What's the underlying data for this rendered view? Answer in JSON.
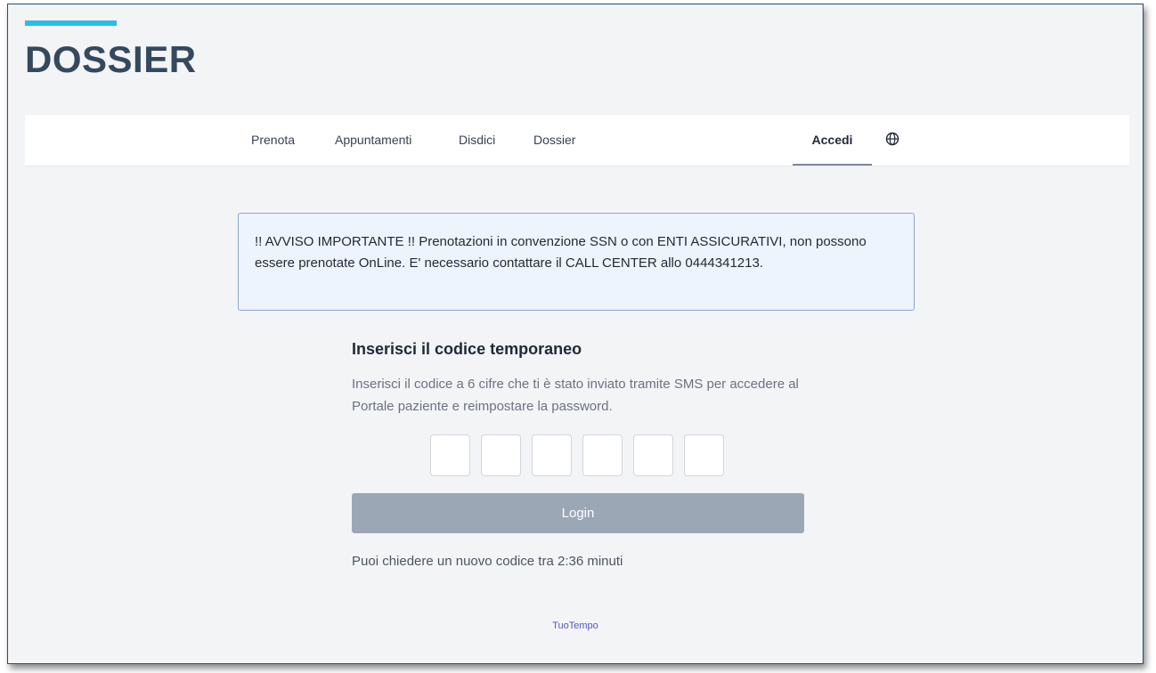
{
  "header": {
    "brand": "DOSSIER",
    "accent_color": "#27bfe6"
  },
  "nav": {
    "items": [
      {
        "label": "Prenota"
      },
      {
        "label": "Appuntamenti"
      },
      {
        "label": "Disdici"
      },
      {
        "label": "Dossier"
      }
    ],
    "login": "Accedi",
    "language_icon": "globe-icon"
  },
  "notice": {
    "text": "!! AVVISO IMPORTANTE !! Prenotazioni in convenzione SSN o con ENTI ASSICURATIVI, non possono essere prenotate OnLine. E' necessario contattare il CALL CENTER allo 0444341213."
  },
  "login": {
    "title": "Inserisci il codice temporaneo",
    "description": "Inserisci il codice a 6 cifre che ti è stato inviato tramite SMS per accedere al Portale paziente e reimpostare la password.",
    "button": "Login",
    "resend": "Puoi chiedere un nuovo codice tra 2:36 minuti"
  },
  "footer": {
    "link": "TuoTempo"
  }
}
